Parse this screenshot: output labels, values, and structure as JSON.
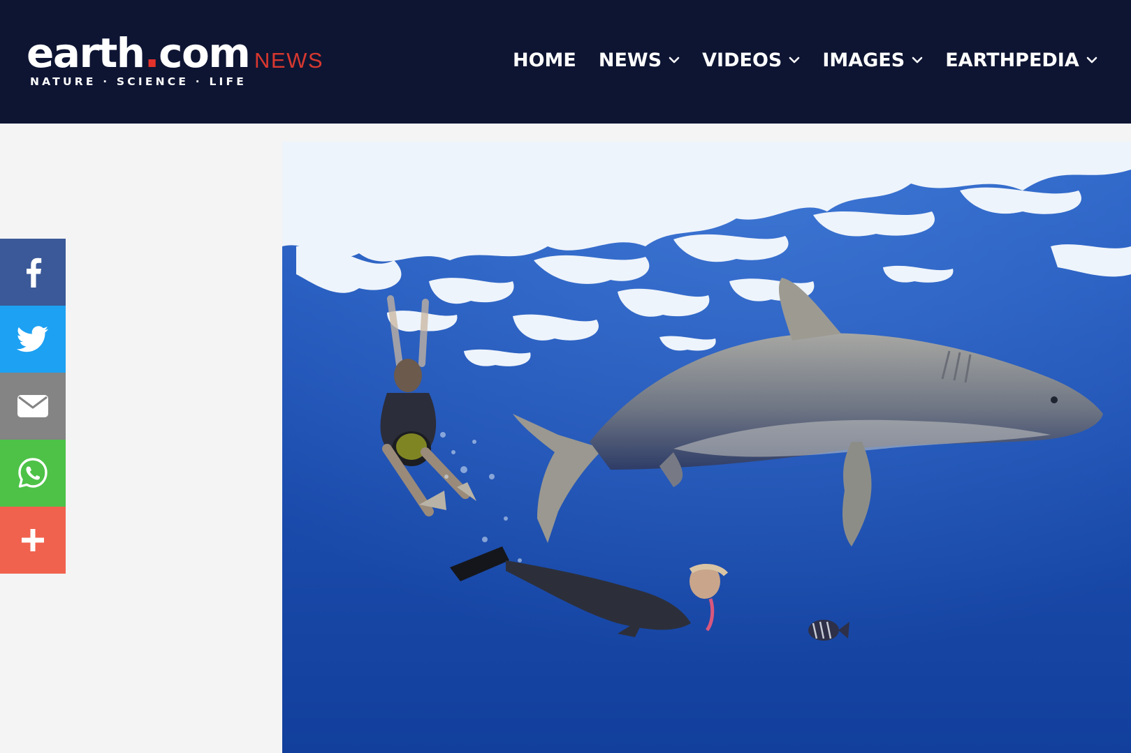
{
  "header": {
    "logo_text": "earth",
    "logo_dot": ".",
    "logo_suffix": "com",
    "tagline": "NATURE · SCIENCE · LIFE",
    "section_label": "NEWS"
  },
  "nav": {
    "items": [
      {
        "label": "HOME",
        "has_dropdown": false
      },
      {
        "label": "NEWS",
        "has_dropdown": true
      },
      {
        "label": "VIDEOS",
        "has_dropdown": true
      },
      {
        "label": "IMAGES",
        "has_dropdown": true
      },
      {
        "label": "EARTHPEDIA",
        "has_dropdown": true
      }
    ]
  },
  "share": {
    "buttons": [
      {
        "network": "facebook",
        "icon": "facebook-icon",
        "color": "#3b5998"
      },
      {
        "network": "twitter",
        "icon": "twitter-icon",
        "color": "#1da1f2"
      },
      {
        "network": "email",
        "icon": "email-icon",
        "color": "#848484"
      },
      {
        "network": "whatsapp",
        "icon": "whatsapp-icon",
        "color": "#4dc247"
      },
      {
        "network": "more",
        "icon": "plus-icon",
        "color": "#f0624e"
      }
    ]
  },
  "hero": {
    "subject": "oceanic whitetip shark swimming near two snorkelers in deep blue water"
  },
  "colors": {
    "header_bg": "#0e1533",
    "brand_red": "#e4322b",
    "page_bg": "#f4f4f4"
  }
}
